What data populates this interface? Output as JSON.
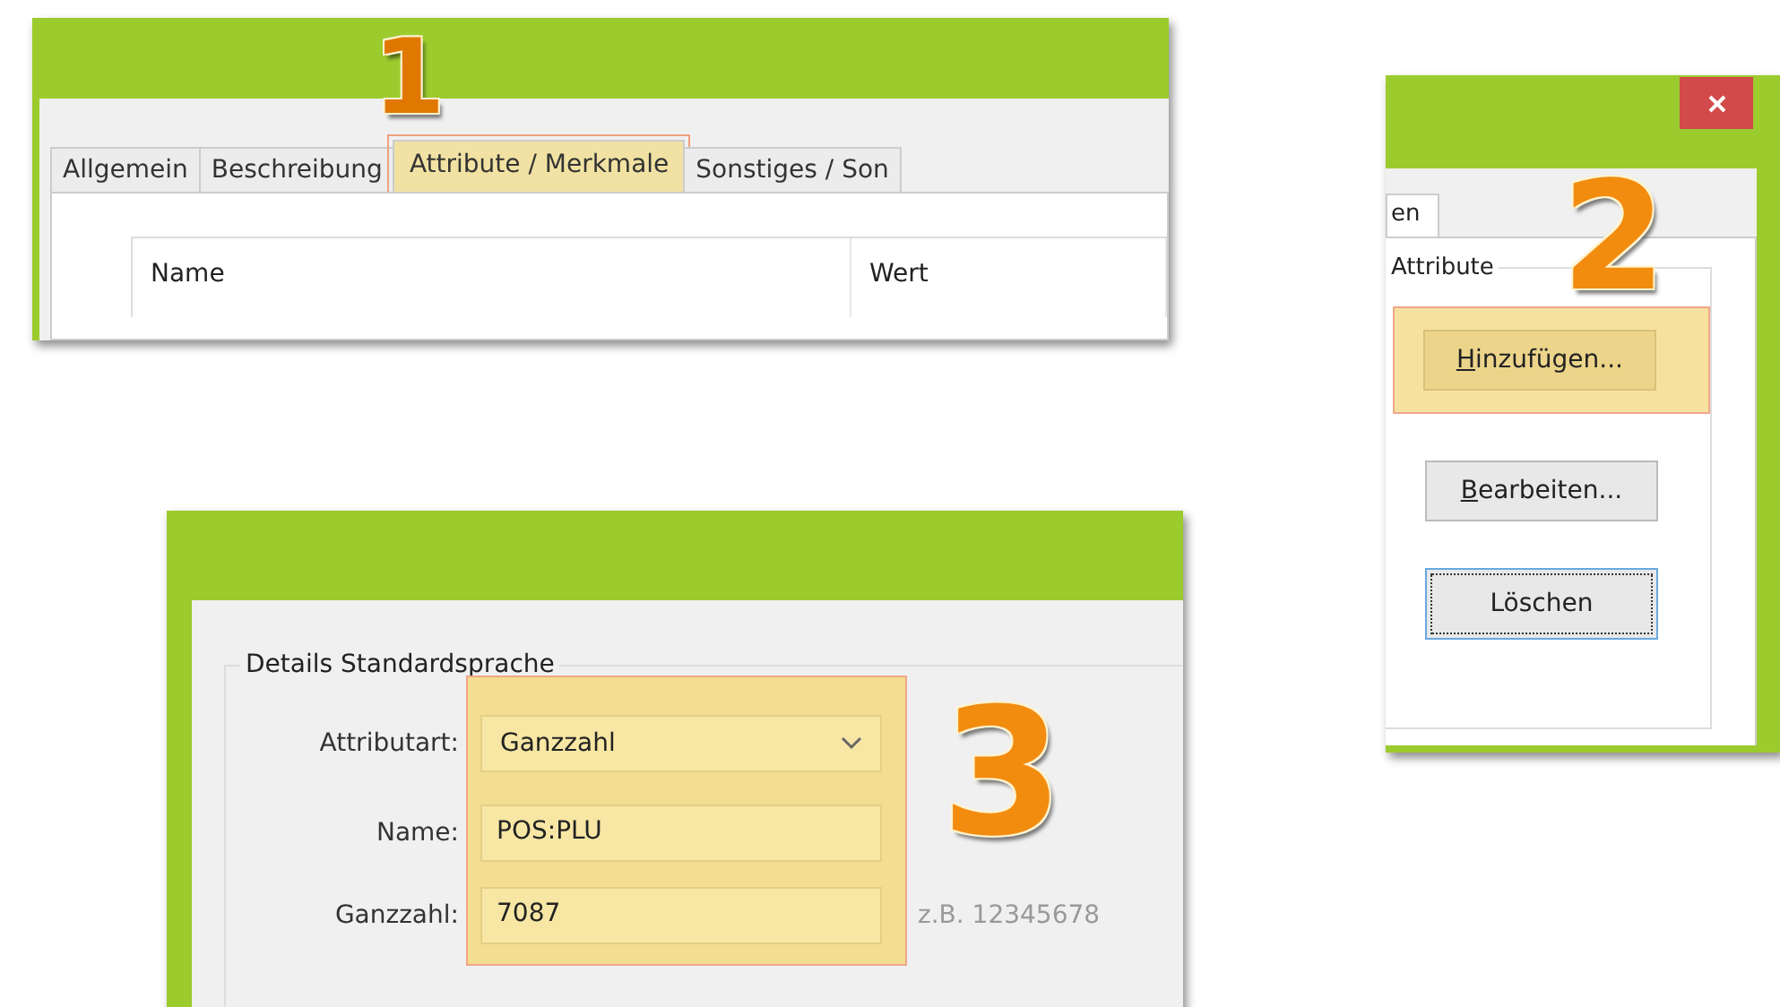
{
  "panel_1": {
    "step": "1",
    "tabs": [
      {
        "label": "Allgemein",
        "selected": false,
        "highlighted": false
      },
      {
        "label": "Beschreibung",
        "selected": false,
        "highlighted": false
      },
      {
        "label": "Attribute / Merkmale",
        "selected": true,
        "highlighted": true
      },
      {
        "label": "Sonstiges / Son",
        "selected": false,
        "highlighted": false
      }
    ],
    "table": {
      "columns": [
        "Name",
        "Wert"
      ]
    }
  },
  "panel_2": {
    "step": "2",
    "tab_fragment": "en",
    "group_title": "Attribute",
    "buttons": [
      {
        "label": "Hinzufügen...",
        "access_key_underlined": true,
        "highlighted": true,
        "focused": false
      },
      {
        "label": "Bearbeiten...",
        "access_key_underlined": true,
        "highlighted": false,
        "focused": false
      },
      {
        "label": "Löschen",
        "access_key_underlined": false,
        "highlighted": false,
        "focused": true
      }
    ]
  },
  "panel_3": {
    "step": "3",
    "group_title": "Details Standardsprache",
    "highlighted": true,
    "fields": [
      {
        "kind": "dropdown",
        "label": "Attributart:",
        "value": "Ganzzahl"
      },
      {
        "kind": "text",
        "label": "Name:",
        "value": "POS:PLU"
      },
      {
        "kind": "text",
        "label": "Ganzzahl:",
        "value": "7087",
        "hint": "z.B. 12345678"
      }
    ]
  }
}
